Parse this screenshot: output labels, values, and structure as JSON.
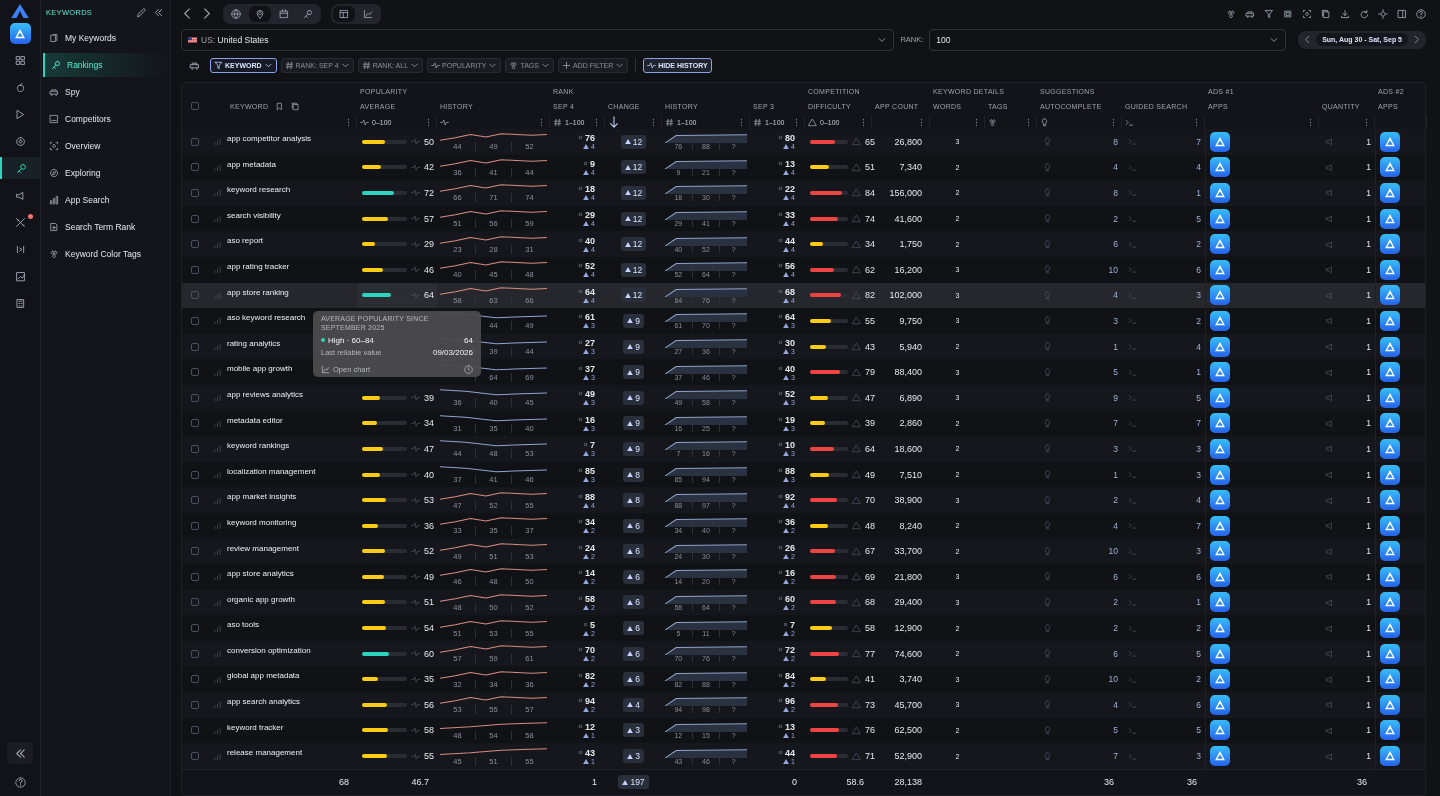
{
  "rail": {
    "items": [
      {
        "selected": false,
        "badge": false
      },
      {
        "selected": false,
        "badge": false
      },
      {
        "selected": false,
        "badge": false
      },
      {
        "selected": false,
        "badge": false
      },
      {
        "selected": true,
        "badge": false
      },
      {
        "selected": false,
        "badge": false
      },
      {
        "selected": false,
        "badge": true
      },
      {
        "selected": false,
        "badge": false
      },
      {
        "selected": false,
        "badge": false
      },
      {
        "selected": false,
        "badge": false
      }
    ]
  },
  "sidebar": {
    "title": "KEYWORDS",
    "items": [
      {
        "label": "My Keywords",
        "selected": false
      },
      {
        "label": "Rankings",
        "selected": true
      },
      {
        "label": "Spy",
        "selected": false
      },
      {
        "label": "Competitors",
        "selected": false
      },
      {
        "label": "Overview",
        "selected": false
      },
      {
        "label": "Exploring",
        "selected": false
      },
      {
        "label": "App Search",
        "selected": false
      },
      {
        "label": "Search Term Rank",
        "selected": false
      },
      {
        "label": "Keyword Color Tags",
        "selected": false
      }
    ]
  },
  "toolbar": {
    "scope_tabs": [
      {
        "selected": false
      },
      {
        "selected": true
      },
      {
        "selected": false
      },
      {
        "selected": false
      }
    ],
    "view_tabs": [
      {
        "selected": true
      },
      {
        "selected": false
      }
    ]
  },
  "country": {
    "code": "US:",
    "value": "United States"
  },
  "rank_select": {
    "label": "RANK:",
    "value": "100"
  },
  "date_range": "Sun, Aug 30 - Sat, Sep 5",
  "filters": [
    {
      "label": "KEYWORD",
      "selected": true,
      "kind": "funnel"
    },
    {
      "label": "RANK: SEP 4",
      "selected": false,
      "kind": "hash"
    },
    {
      "label": "RANK: ALL",
      "selected": false,
      "kind": "hash"
    },
    {
      "label": "POPULARITY",
      "selected": false,
      "kind": "pulse"
    },
    {
      "label": "TAGS",
      "selected": false,
      "kind": "tags"
    },
    {
      "label": "ADD FILTER",
      "selected": false,
      "kind": "plus"
    }
  ],
  "hide_history": "HIDE HISTORY",
  "table": {
    "select_all": {
      "checked": false
    },
    "columns": [
      {
        "label": "KEYWORD"
      },
      {
        "group": "POPULARITY",
        "label": "AVERAGE",
        "filter": "0–100",
        "kind": "pulse"
      },
      {
        "label": "HISTORY",
        "kind": "pulse"
      },
      {
        "group": "RANK",
        "label": "SEP 4",
        "filter": "1–100",
        "kind": "hash"
      },
      {
        "label": "CHANGE",
        "kind": "sort"
      },
      {
        "label": "HISTORY",
        "filter": "1–100",
        "kind": "hash"
      },
      {
        "label": "SEP 3",
        "filter": "1–100",
        "kind": "hash"
      },
      {
        "group": "COMPETITION",
        "label": "DIFFICULTY",
        "filter": "0–100",
        "kind": "warning"
      },
      {
        "label": "APP COUNT"
      },
      {
        "group": "KEYWORD DETAILS",
        "label": "WORDS"
      },
      {
        "label": "TAGS",
        "kind": "tags"
      },
      {
        "group": "SUGGESTIONS",
        "label": "AUTOCOMPLETE",
        "kind": "bulb"
      },
      {
        "label": "GUIDED SEARCH",
        "kind": "prompt"
      },
      {
        "group": "ADS #1",
        "label": "APPS"
      },
      {
        "label": "QUANTITY"
      },
      {
        "group": "ADS #2",
        "label": "APPS"
      }
    ],
    "rows": [
      {
        "keyword": "app competitor analysis",
        "checked": false,
        "selected": false,
        "popularity": {
          "value": "50",
          "level": 0.5
        },
        "pop_history": {
          "kind": "up",
          "labels": [
            "44",
            "49",
            "52"
          ]
        },
        "rank": {
          "value": "76",
          "delta": "4"
        },
        "change": "12",
        "rank_history": [
          "76",
          "88",
          "?"
        ],
        "prev_rank": {
          "value": "80",
          "delta": "4"
        },
        "difficulty": {
          "value": "65",
          "level": 0.65
        },
        "app_count": "26,800",
        "words": "3",
        "autocomplete": "8",
        "guided": "7",
        "quantity": "1"
      },
      {
        "keyword": "app metadata",
        "checked": false,
        "selected": false,
        "popularity": {
          "value": "42",
          "level": 0.42
        },
        "pop_history": {
          "kind": "up",
          "labels": [
            "36",
            "41",
            "44"
          ]
        },
        "rank": {
          "value": "9",
          "delta": "4"
        },
        "change": "12",
        "rank_history": [
          "9",
          "21",
          "?"
        ],
        "prev_rank": {
          "value": "13",
          "delta": "4"
        },
        "difficulty": {
          "value": "51",
          "level": 0.51
        },
        "app_count": "7,340",
        "words": "2",
        "autocomplete": "4",
        "guided": "4",
        "quantity": "1"
      },
      {
        "keyword": "keyword research",
        "checked": false,
        "selected": false,
        "popularity": {
          "value": "72",
          "level": 0.72
        },
        "pop_history": {
          "kind": "up",
          "labels": [
            "66",
            "71",
            "74"
          ]
        },
        "rank": {
          "value": "18",
          "delta": "4"
        },
        "change": "12",
        "rank_history": [
          "18",
          "30",
          "?"
        ],
        "prev_rank": {
          "value": "22",
          "delta": "4"
        },
        "difficulty": {
          "value": "84",
          "level": 0.84
        },
        "app_count": "156,000",
        "words": "2",
        "autocomplete": "8",
        "guided": "1",
        "quantity": "1"
      },
      {
        "keyword": "search visibility",
        "checked": false,
        "selected": false,
        "popularity": {
          "value": "57",
          "level": 0.57
        },
        "pop_history": {
          "kind": "up",
          "labels": [
            "51",
            "56",
            "59"
          ]
        },
        "rank": {
          "value": "29",
          "delta": "4"
        },
        "change": "12",
        "rank_history": [
          "29",
          "41",
          "?"
        ],
        "prev_rank": {
          "value": "33",
          "delta": "4"
        },
        "difficulty": {
          "value": "74",
          "level": 0.74
        },
        "app_count": "41,600",
        "words": "2",
        "autocomplete": "2",
        "guided": "5",
        "quantity": "1"
      },
      {
        "keyword": "aso report",
        "checked": false,
        "selected": false,
        "popularity": {
          "value": "29",
          "level": 0.29
        },
        "pop_history": {
          "kind": "up",
          "labels": [
            "23",
            "28",
            "31"
          ]
        },
        "rank": {
          "value": "40",
          "delta": "4"
        },
        "change": "12",
        "rank_history": [
          "40",
          "52",
          "?"
        ],
        "prev_rank": {
          "value": "44",
          "delta": "4"
        },
        "difficulty": {
          "value": "34",
          "level": 0.34
        },
        "app_count": "1,750",
        "words": "2",
        "autocomplete": "6",
        "guided": "2",
        "quantity": "1"
      },
      {
        "keyword": "app rating tracker",
        "checked": false,
        "selected": false,
        "popularity": {
          "value": "46",
          "level": 0.46
        },
        "pop_history": {
          "kind": "up",
          "labels": [
            "40",
            "45",
            "48"
          ]
        },
        "rank": {
          "value": "52",
          "delta": "4"
        },
        "change": "12",
        "rank_history": [
          "52",
          "64",
          "?"
        ],
        "prev_rank": {
          "value": "56",
          "delta": "4"
        },
        "difficulty": {
          "value": "62",
          "level": 0.62
        },
        "app_count": "16,200",
        "words": "3",
        "autocomplete": "10",
        "guided": "6",
        "quantity": "1"
      },
      {
        "keyword": "app store ranking",
        "checked": false,
        "selected": true,
        "popularity": {
          "value": "64",
          "level": 0.64
        },
        "pop_history": {
          "kind": "up",
          "labels": [
            "58",
            "63",
            "66"
          ]
        },
        "rank": {
          "value": "64",
          "delta": "4"
        },
        "change": "12",
        "rank_history": [
          "64",
          "76",
          "?"
        ],
        "prev_rank": {
          "value": "68",
          "delta": "4"
        },
        "difficulty": {
          "value": "82",
          "level": 0.82
        },
        "app_count": "102,000",
        "words": "3",
        "autocomplete": "4",
        "guided": "3",
        "quantity": "1"
      },
      {
        "keyword": "aso keyword research",
        "checked": false,
        "selected": false,
        "pop_history": {
          "kind": "down",
          "first_hidden": true,
          "labels": [
            "44",
            "49"
          ]
        },
        "rank": {
          "value": "61",
          "delta": "3"
        },
        "change": "9",
        "rank_history": [
          "61",
          "70",
          "?"
        ],
        "prev_rank": {
          "value": "64",
          "delta": "3"
        },
        "difficulty": {
          "value": "55",
          "level": 0.55
        },
        "app_count": "9,750",
        "words": "3",
        "autocomplete": "3",
        "guided": "2",
        "quantity": "1"
      },
      {
        "keyword": "rating analytics",
        "checked": false,
        "selected": false,
        "pop_history": {
          "kind": "down",
          "first_hidden": true,
          "labels": [
            "39",
            "44"
          ]
        },
        "rank": {
          "value": "27",
          "delta": "3"
        },
        "change": "9",
        "rank_history": [
          "27",
          "36",
          "?"
        ],
        "prev_rank": {
          "value": "30",
          "delta": "3"
        },
        "difficulty": {
          "value": "43",
          "level": 0.43
        },
        "app_count": "5,940",
        "words": "2",
        "autocomplete": "1",
        "guided": "4",
        "quantity": "1"
      },
      {
        "keyword": "mobile app growth",
        "checked": false,
        "selected": false,
        "pop_history": {
          "kind": "down",
          "first_hidden": true,
          "labels": [
            "64",
            "69"
          ]
        },
        "rank": {
          "value": "37",
          "delta": "3"
        },
        "change": "9",
        "rank_history": [
          "37",
          "46",
          "?"
        ],
        "prev_rank": {
          "value": "40",
          "delta": "3"
        },
        "difficulty": {
          "value": "79",
          "level": 0.79
        },
        "app_count": "88,400",
        "words": "3",
        "autocomplete": "5",
        "guided": "1",
        "quantity": "1"
      },
      {
        "keyword": "app reviews analytics",
        "checked": false,
        "selected": false,
        "popularity": {
          "value": "39",
          "level": 0.39
        },
        "pop_history": {
          "kind": "down",
          "labels": [
            "36",
            "40",
            "45"
          ]
        },
        "rank": {
          "value": "49",
          "delta": "3"
        },
        "change": "9",
        "rank_history": [
          "49",
          "58",
          "?"
        ],
        "prev_rank": {
          "value": "52",
          "delta": "3"
        },
        "difficulty": {
          "value": "47",
          "level": 0.47
        },
        "app_count": "6,890",
        "words": "3",
        "autocomplete": "9",
        "guided": "5",
        "quantity": "1"
      },
      {
        "keyword": "metadata editor",
        "checked": false,
        "selected": false,
        "popularity": {
          "value": "34",
          "level": 0.34
        },
        "pop_history": {
          "kind": "down",
          "labels": [
            "31",
            "35",
            "40"
          ]
        },
        "rank": {
          "value": "16",
          "delta": "3"
        },
        "change": "9",
        "rank_history": [
          "16",
          "25",
          "?"
        ],
        "prev_rank": {
          "value": "19",
          "delta": "3"
        },
        "difficulty": {
          "value": "39",
          "level": 0.39
        },
        "app_count": "2,860",
        "words": "2",
        "autocomplete": "7",
        "guided": "7",
        "quantity": "1"
      },
      {
        "keyword": "keyword rankings",
        "checked": false,
        "selected": false,
        "popularity": {
          "value": "47",
          "level": 0.47
        },
        "pop_history": {
          "kind": "down",
          "labels": [
            "44",
            "48",
            "53"
          ]
        },
        "rank": {
          "value": "7",
          "delta": "3"
        },
        "change": "9",
        "rank_history": [
          "7",
          "16",
          "?"
        ],
        "prev_rank": {
          "value": "10",
          "delta": "3"
        },
        "difficulty": {
          "value": "64",
          "level": 0.64
        },
        "app_count": "18,600",
        "words": "2",
        "autocomplete": "3",
        "guided": "3",
        "quantity": "1"
      },
      {
        "keyword": "localization management",
        "checked": false,
        "selected": false,
        "popularity": {
          "value": "40",
          "level": 0.4
        },
        "pop_history": {
          "kind": "down",
          "labels": [
            "37",
            "41",
            "46"
          ]
        },
        "rank": {
          "value": "85",
          "delta": "3"
        },
        "change": "8",
        "rank_history": [
          "85",
          "94",
          "?"
        ],
        "prev_rank": {
          "value": "88",
          "delta": "3"
        },
        "difficulty": {
          "value": "49",
          "level": 0.49
        },
        "app_count": "7,510",
        "words": "2",
        "autocomplete": "1",
        "guided": "3",
        "quantity": "1"
      },
      {
        "keyword": "app market insights",
        "checked": false,
        "selected": false,
        "popularity": {
          "value": "53",
          "level": 0.53
        },
        "pop_history": {
          "kind": "up",
          "labels": [
            "47",
            "52",
            "55"
          ]
        },
        "rank": {
          "value": "88",
          "delta": "4"
        },
        "change": "8",
        "rank_history": [
          "88",
          "97",
          "?"
        ],
        "prev_rank": {
          "value": "92",
          "delta": "4"
        },
        "difficulty": {
          "value": "70",
          "level": 0.7
        },
        "app_count": "38,900",
        "words": "3",
        "autocomplete": "2",
        "guided": "4",
        "quantity": "1"
      },
      {
        "keyword": "keyword monitoring",
        "checked": false,
        "selected": false,
        "popularity": {
          "value": "36",
          "level": 0.36
        },
        "pop_history": {
          "kind": "up",
          "labels": [
            "33",
            "35",
            "37"
          ]
        },
        "rank": {
          "value": "34",
          "delta": "2"
        },
        "change": "6",
        "rank_history": [
          "34",
          "40",
          "?"
        ],
        "prev_rank": {
          "value": "36",
          "delta": "2"
        },
        "difficulty": {
          "value": "48",
          "level": 0.48
        },
        "app_count": "8,240",
        "words": "2",
        "autocomplete": "4",
        "guided": "7",
        "quantity": "1"
      },
      {
        "keyword": "review management",
        "checked": false,
        "selected": false,
        "popularity": {
          "value": "52",
          "level": 0.52
        },
        "pop_history": {
          "kind": "up",
          "labels": [
            "49",
            "51",
            "53"
          ]
        },
        "rank": {
          "value": "24",
          "delta": "2"
        },
        "change": "6",
        "rank_history": [
          "24",
          "30",
          "?"
        ],
        "prev_rank": {
          "value": "26",
          "delta": "2"
        },
        "difficulty": {
          "value": "67",
          "level": 0.67
        },
        "app_count": "33,700",
        "words": "2",
        "autocomplete": "10",
        "guided": "3",
        "quantity": "1"
      },
      {
        "keyword": "app store analytics",
        "checked": false,
        "selected": false,
        "popularity": {
          "value": "49",
          "level": 0.49
        },
        "pop_history": {
          "kind": "up",
          "labels": [
            "46",
            "48",
            "50"
          ]
        },
        "rank": {
          "value": "14",
          "delta": "2"
        },
        "change": "6",
        "rank_history": [
          "14",
          "20",
          "?"
        ],
        "prev_rank": {
          "value": "16",
          "delta": "2"
        },
        "difficulty": {
          "value": "69",
          "level": 0.69
        },
        "app_count": "21,800",
        "words": "3",
        "autocomplete": "6",
        "guided": "6",
        "quantity": "1"
      },
      {
        "keyword": "organic app growth",
        "checked": false,
        "selected": false,
        "popularity": {
          "value": "51",
          "level": 0.51
        },
        "pop_history": {
          "kind": "up",
          "labels": [
            "48",
            "50",
            "52"
          ]
        },
        "rank": {
          "value": "58",
          "delta": "2"
        },
        "change": "6",
        "rank_history": [
          "58",
          "64",
          "?"
        ],
        "prev_rank": {
          "value": "60",
          "delta": "2"
        },
        "difficulty": {
          "value": "68",
          "level": 0.68
        },
        "app_count": "29,400",
        "words": "3",
        "autocomplete": "2",
        "guided": "1",
        "quantity": "1"
      },
      {
        "keyword": "aso tools",
        "checked": false,
        "selected": false,
        "popularity": {
          "value": "54",
          "level": 0.54
        },
        "pop_history": {
          "kind": "up",
          "labels": [
            "51",
            "53",
            "55"
          ]
        },
        "rank": {
          "value": "5",
          "delta": "2"
        },
        "change": "6",
        "rank_history": [
          "5",
          "11",
          "?"
        ],
        "prev_rank": {
          "value": "7",
          "delta": "2"
        },
        "difficulty": {
          "value": "58",
          "level": 0.58
        },
        "app_count": "12,900",
        "words": "2",
        "autocomplete": "2",
        "guided": "2",
        "quantity": "1"
      },
      {
        "keyword": "conversion optimization",
        "checked": false,
        "selected": false,
        "popularity": {
          "value": "60",
          "level": 0.6
        },
        "pop_history": {
          "kind": "up",
          "labels": [
            "57",
            "59",
            "61"
          ]
        },
        "rank": {
          "value": "70",
          "delta": "2"
        },
        "change": "6",
        "rank_history": [
          "70",
          "76",
          "?"
        ],
        "prev_rank": {
          "value": "72",
          "delta": "2"
        },
        "difficulty": {
          "value": "77",
          "level": 0.77
        },
        "app_count": "74,600",
        "words": "2",
        "autocomplete": "6",
        "guided": "5",
        "quantity": "1"
      },
      {
        "keyword": "global app metadata",
        "checked": false,
        "selected": false,
        "popularity": {
          "value": "35",
          "level": 0.35
        },
        "pop_history": {
          "kind": "up",
          "labels": [
            "32",
            "34",
            "36"
          ]
        },
        "rank": {
          "value": "82",
          "delta": "2"
        },
        "change": "6",
        "rank_history": [
          "82",
          "88",
          "?"
        ],
        "prev_rank": {
          "value": "84",
          "delta": "2"
        },
        "difficulty": {
          "value": "41",
          "level": 0.41
        },
        "app_count": "3,740",
        "words": "3",
        "autocomplete": "10",
        "guided": "2",
        "quantity": "1"
      },
      {
        "keyword": "app search analytics",
        "checked": false,
        "selected": false,
        "popularity": {
          "value": "56",
          "level": 0.56
        },
        "pop_history": {
          "kind": "up",
          "labels": [
            "53",
            "55",
            "57"
          ]
        },
        "rank": {
          "value": "94",
          "delta": "2"
        },
        "change": "4",
        "rank_history": [
          "94",
          "98",
          "?"
        ],
        "prev_rank": {
          "value": "96",
          "delta": "2"
        },
        "difficulty": {
          "value": "73",
          "level": 0.73
        },
        "app_count": "45,700",
        "words": "3",
        "autocomplete": "4",
        "guided": "6",
        "quantity": "1"
      },
      {
        "keyword": "keyword tracker",
        "checked": false,
        "selected": false,
        "popularity": {
          "value": "58",
          "level": 0.58
        },
        "pop_history": {
          "kind": "rise",
          "labels": [
            "48",
            "54",
            "58"
          ]
        },
        "rank": {
          "value": "12",
          "delta": "1"
        },
        "change": "3",
        "rank_history": [
          "12",
          "15",
          "?"
        ],
        "prev_rank": {
          "value": "13",
          "delta": "1"
        },
        "difficulty": {
          "value": "76",
          "level": 0.76
        },
        "app_count": "62,500",
        "words": "2",
        "autocomplete": "5",
        "guided": "5",
        "quantity": "1"
      },
      {
        "keyword": "release management",
        "checked": false,
        "selected": false,
        "popularity": {
          "value": "55",
          "level": 0.55
        },
        "pop_history": {
          "kind": "rise",
          "labels": [
            "45",
            "51",
            "55"
          ]
        },
        "rank": {
          "value": "43",
          "delta": "1"
        },
        "change": "3",
        "rank_history": [
          "43",
          "46",
          "?"
        ],
        "prev_rank": {
          "value": "44",
          "delta": "1"
        },
        "difficulty": {
          "value": "71",
          "level": 0.71
        },
        "app_count": "52,900",
        "words": "2",
        "autocomplete": "7",
        "guided": "3",
        "quantity": "1"
      }
    ],
    "totals": {
      "keywords": "68",
      "popularity": "46.7",
      "rank": "1",
      "change": "197",
      "prev_rank": "0",
      "difficulty": "58.6",
      "app_count": "28,138",
      "autocomplete": "36",
      "guided": "36",
      "quantity": "36"
    }
  },
  "tooltip": {
    "title": "AVERAGE POPULARITY SINCE SEPTEMBER 2025",
    "band": "High · 60–84",
    "color": "#2dd4bf",
    "value": "64",
    "note": "Last reliable value",
    "date": "09/03/2026",
    "action": "Open chart"
  }
}
